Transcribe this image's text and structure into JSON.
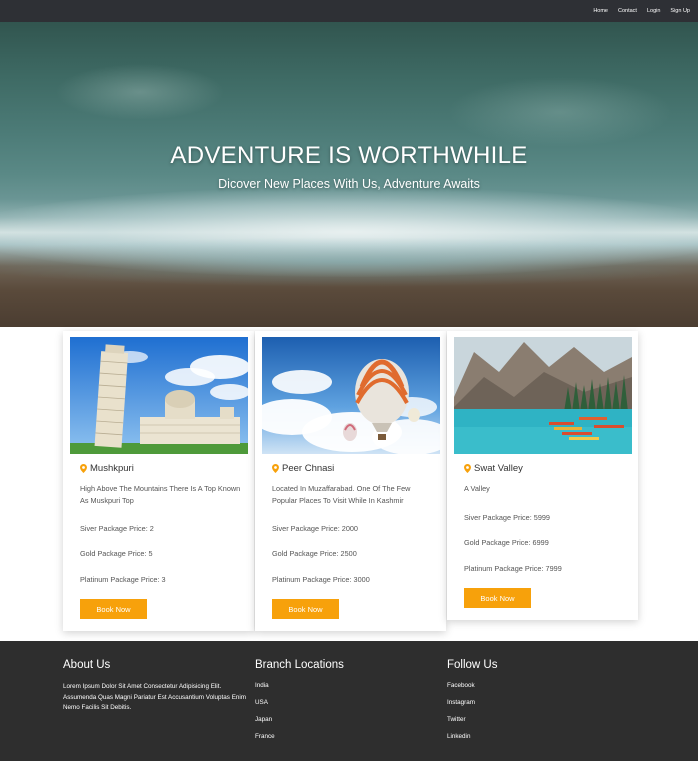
{
  "nav": {
    "items": [
      "Home",
      "Contact",
      "Login",
      "Sign Up"
    ]
  },
  "hero": {
    "title": "ADVENTURE IS WORTHWHILE",
    "subtitle": "Dicover New Places With Us, Adventure Awaits"
  },
  "cards": [
    {
      "location": "Mushkpuri",
      "description": "High Above The Mountains There Is A Top Known As Muskpuri Top",
      "silver": "Siver Package Price: 2",
      "gold": "Gold Package Price: 5",
      "platinum": "Platinum Package Price: 3",
      "button": "Book Now"
    },
    {
      "location": "Peer Chnasi",
      "description": "Located In Muzaffarabad. One Of The Few Popular Places To Visit While In Kashmir",
      "silver": "Siver Package Price: 2000",
      "gold": "Gold Package Price: 2500",
      "platinum": "Platinum Package Price: 3000",
      "button": "Book Now"
    },
    {
      "location": "Swat Valley",
      "description": "A Valley",
      "silver": "Siver Package Price: 5999",
      "gold": "Gold Package Price: 6999",
      "platinum": "Platinum Package Price: 7999",
      "button": "Book Now"
    }
  ],
  "footer": {
    "about": {
      "title": "About Us",
      "text": "Lorem Ipsum Dolor Sit Amet Consectetur Adipisicing Elit. Assumenda Quas Magni Pariatur Est Accusantium Voluptas Enim Nemo Facilis Sit Debitis."
    },
    "branches": {
      "title": "Branch Locations",
      "items": [
        "India",
        "USA",
        "Japan",
        "France"
      ]
    },
    "follow": {
      "title": "Follow Us",
      "items": [
        "Facebook",
        "Instagram",
        "Twitter",
        "Linkedin"
      ]
    }
  },
  "colors": {
    "accent": "#f7a10b",
    "nav_bg": "#2e3035",
    "footer_bg": "#2e2e2e"
  },
  "icons": {
    "location": "map-pin-icon"
  }
}
